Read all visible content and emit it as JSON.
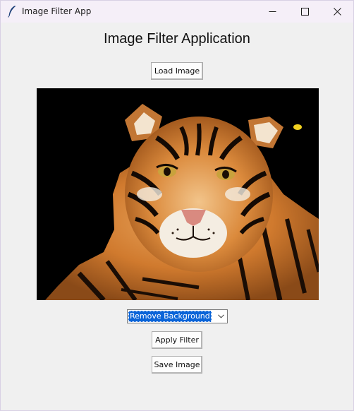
{
  "window": {
    "title": "Image Filter App"
  },
  "main": {
    "heading": "Image Filter Application",
    "load_button": "Load Image",
    "filter_select": {
      "value": "Remove Background"
    },
    "apply_button": "Apply Filter",
    "save_button": "Save Image",
    "image": {
      "subject": "tiger",
      "background": "#000000"
    }
  },
  "colors": {
    "selection": "#0a64d8",
    "window_bg": "#f0f0f0",
    "titlebar_bg": "#f5eff8"
  }
}
